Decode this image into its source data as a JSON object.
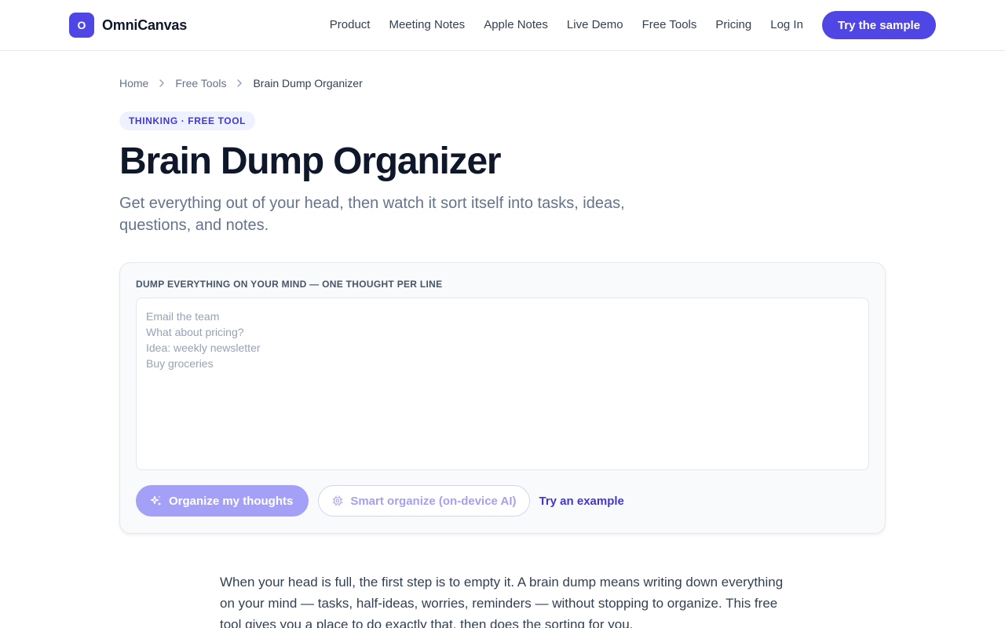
{
  "brand": {
    "mark": "O",
    "name": "OmniCanvas"
  },
  "nav": {
    "links": [
      "Product",
      "Meeting Notes",
      "Apple Notes",
      "Live Demo",
      "Free Tools",
      "Pricing",
      "Log In"
    ],
    "cta": "Try the sample"
  },
  "breadcrumb": {
    "home": "Home",
    "section": "Free Tools",
    "current": "Brain Dump Organizer"
  },
  "hero": {
    "tag": "THINKING · FREE TOOL",
    "title": "Brain Dump Organizer",
    "subtitle": "Get everything out of your head, then watch it sort itself into tasks, ideas, questions, and notes."
  },
  "tool": {
    "label": "DUMP EVERYTHING ON YOUR MIND — ONE THOUGHT PER LINE",
    "placeholder": "Email the team\nWhat about pricing?\nIdea: weekly newsletter\nBuy groceries",
    "value": "",
    "organize_label": "Organize my thoughts",
    "smart_label": "Smart organize (on-device AI)",
    "example_label": "Try an example"
  },
  "intro": "When your head is full, the first step is to empty it. A brain dump means writing down everything on your mind — tasks, half-ideas, worries, reminders — without stopping to organize. This free tool gives you a place to do exactly that, then does the sorting for you."
}
